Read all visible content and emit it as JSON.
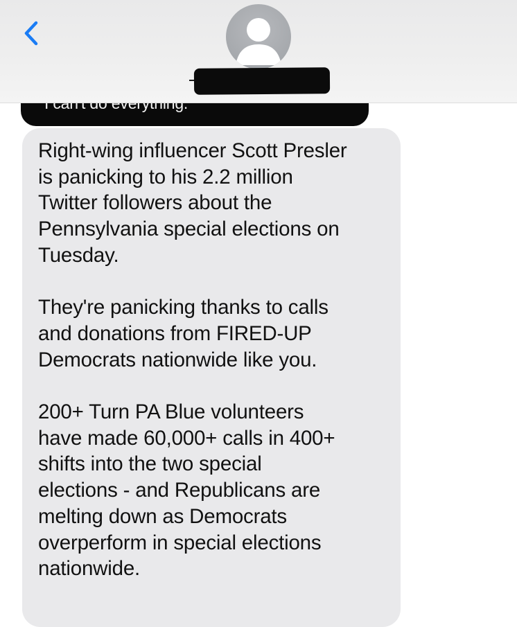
{
  "header": {
    "back_icon": "chevron-left-icon",
    "avatar_icon": "person-silhouette-icon",
    "contact_name_redacted": true,
    "accent_color": "#1a7cf5"
  },
  "previous_message": {
    "text": "I can't do everything."
  },
  "message": {
    "paragraphs": [
      "Right-wing influencer Scott Presler\nis panicking to his 2.2 million\nTwitter followers about the\nPennsylvania special elections on\nTuesday.",
      "They're panicking thanks to calls\nand donations from FIRED-UP\nDemocrats nationwide like you.",
      "200+ Turn PA Blue volunteers\nhave made 60,000+ calls in 400+\nshifts into the two special\nelections - and Republicans are\nmelting down as Democrats\noverperform in special elections\nnationwide."
    ]
  }
}
